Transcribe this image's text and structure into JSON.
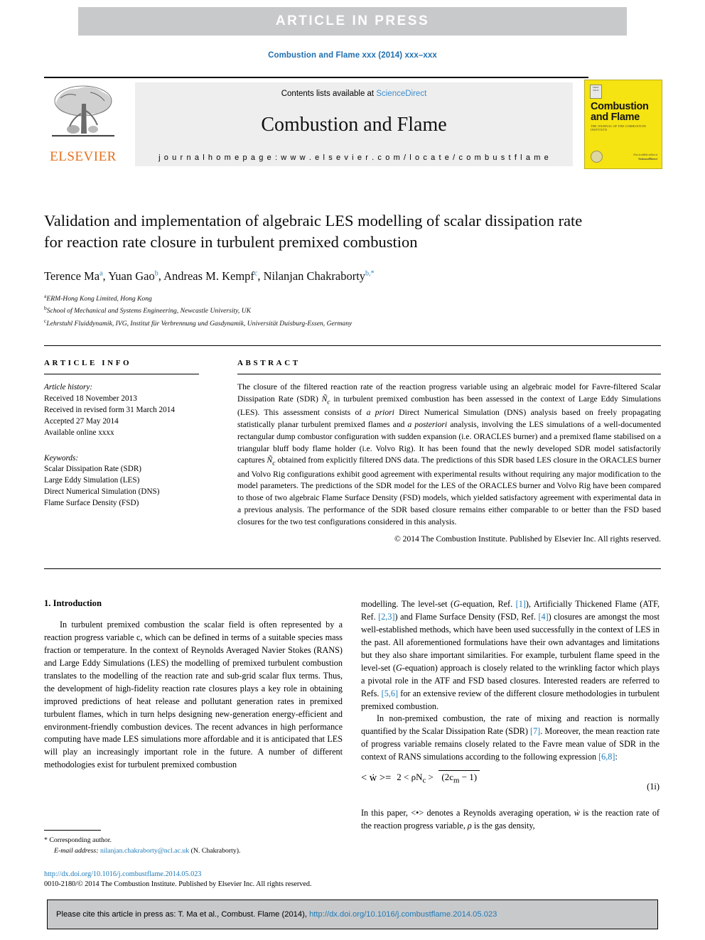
{
  "banner": {
    "text": "ARTICLE IN PRESS"
  },
  "running_head": {
    "text": "Combustion and Flame xxx (2014) xxx–xxx"
  },
  "masthead": {
    "contents_prefix": "Contents lists available at ",
    "sciencedirect": "ScienceDirect",
    "journal_name": "Combustion and Flame",
    "homepage": "j o u r n a l   h o m e p a g e :   w w w . e l s e v i e r . c o m / l o c a t e / c o m b u s t f l a m e",
    "publisher": "ELSEVIER"
  },
  "cover": {
    "badge": "FIRST PAGE",
    "title": "Combustion and Flame",
    "subtitle": "THE JOURNAL OF THE COMBUSTION INSTITUTE",
    "science_direct_note": "Also available online at",
    "science_direct": "ScienceDirect"
  },
  "article": {
    "title": "Validation and implementation of algebraic LES modelling of scalar dissipation rate for reaction rate closure in turbulent premixed combustion",
    "authors": [
      {
        "name": "Terence Ma",
        "mark": "a"
      },
      {
        "name": "Yuan Gao",
        "mark": "b"
      },
      {
        "name": "Andreas M. Kempf",
        "mark": "c"
      },
      {
        "name": "Nilanjan Chakraborty",
        "mark": "b,*"
      }
    ],
    "affiliations": [
      {
        "mark": "a",
        "text": "ERM-Hong Kong Limited, Hong Kong"
      },
      {
        "mark": "b",
        "text": "School of Mechanical and Systems Engineering, Newcastle University, UK"
      },
      {
        "mark": "c",
        "text": "Lehrstuhl Fluiddynamik, IVG, Institut für Verbrennung und Gasdynamik, Universität Duisburg-Essen, Germany"
      }
    ]
  },
  "article_info": {
    "heading": "ARTICLE INFO",
    "history_label": "Article history:",
    "history": [
      "Received 18 November 2013",
      "Received in revised form 31 March 2014",
      "Accepted 27 May 2014",
      "Available online xxxx"
    ],
    "keywords_label": "Keywords:",
    "keywords": [
      "Scalar Dissipation Rate (SDR)",
      "Large Eddy Simulation (LES)",
      "Direct Numerical Simulation (DNS)",
      "Flame Surface Density (FSD)"
    ]
  },
  "abstract": {
    "heading": "ABSTRACT",
    "copyright": "© 2014 The Combustion Institute. Published by Elsevier Inc. All rights reserved."
  },
  "introduction": {
    "heading": "1. Introduction",
    "para1_part1": "In turbulent premixed combustion the scalar field is often represented by a reaction progress variable c, which can be defined in terms of a suitable species mass fraction or temperature. In the context of Reynolds Averaged Navier Stokes (RANS) and Large Eddy Simulations (LES) the modelling of premixed turbulent combustion translates to the modelling of the reaction rate and sub-grid scalar flux terms. Thus, the development of high-fidelity reaction rate closures plays a key role in obtaining improved predictions of heat release and pollutant generation rates in premixed turbulent flames, which in turn helps designing new-generation energy-efficient and environment-friendly combustion devices. The recent advances in high performance computing have made LES simulations more affordable and it is anticipated that LES will play an increasingly important role in the future. A number of different methodologies exist for turbulent premixed combustion"
  },
  "footnote": {
    "star": "*",
    "corresponding": "Corresponding author.",
    "email_label": "E-mail address:",
    "email": "nilanjan.chakraborty@ncl.ac.uk",
    "email_suffix": "(N. Chakraborty).",
    "doi": "http://dx.doi.org/10.1016/j.combustflame.2014.05.023",
    "issn_line": "0010-2180/© 2014 The Combustion Institute. Published by Elsevier Inc. All rights reserved."
  },
  "equation": {
    "lhs": "< ẇ >=",
    "numerator": "2 < ρN",
    "numerator_sub": "c",
    "numerator_tail": " >",
    "denominator": "(2c",
    "denominator_sub": "m",
    "denominator_tail": " − 1)",
    "number": "(1i)"
  },
  "cite_footer": {
    "text": "Please cite this article in press as: T. Ma et al., Combust. Flame (2014), ",
    "link": "http://dx.doi.org/10.1016/j.combustflame.2014.05.023"
  },
  "colors": {
    "banner_gray": "#c8c9cb",
    "link_blue": "#1f7ab5",
    "elsevier_orange": "#e8701a",
    "cover_yellow": "#f5e312"
  }
}
